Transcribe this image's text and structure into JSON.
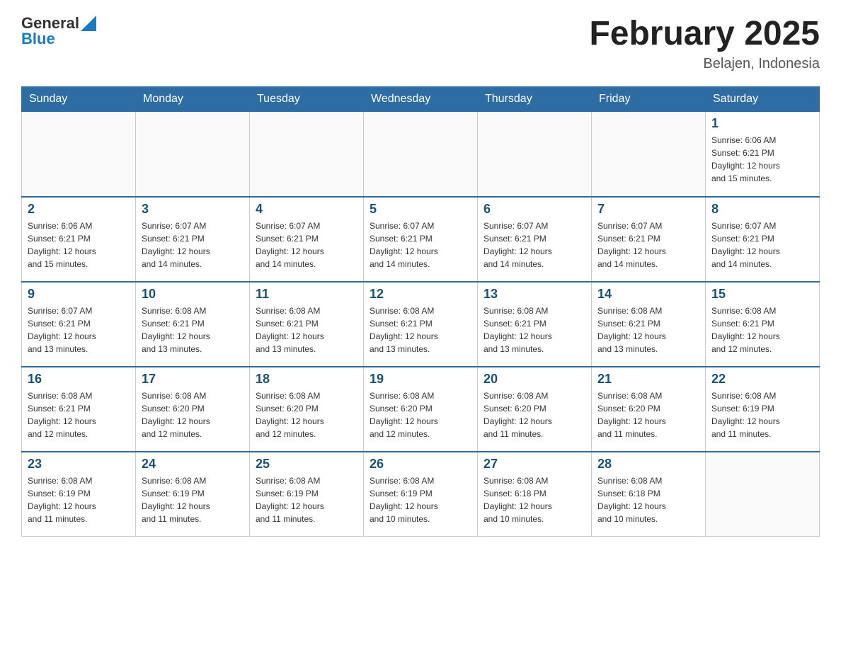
{
  "header": {
    "title": "February 2025",
    "location": "Belajen, Indonesia"
  },
  "logo": {
    "line1": "General",
    "line2": "Blue"
  },
  "weekdays": [
    "Sunday",
    "Monday",
    "Tuesday",
    "Wednesday",
    "Thursday",
    "Friday",
    "Saturday"
  ],
  "weeks": [
    [
      {
        "day": "",
        "info": ""
      },
      {
        "day": "",
        "info": ""
      },
      {
        "day": "",
        "info": ""
      },
      {
        "day": "",
        "info": ""
      },
      {
        "day": "",
        "info": ""
      },
      {
        "day": "",
        "info": ""
      },
      {
        "day": "1",
        "info": "Sunrise: 6:06 AM\nSunset: 6:21 PM\nDaylight: 12 hours\nand 15 minutes."
      }
    ],
    [
      {
        "day": "2",
        "info": "Sunrise: 6:06 AM\nSunset: 6:21 PM\nDaylight: 12 hours\nand 15 minutes."
      },
      {
        "day": "3",
        "info": "Sunrise: 6:07 AM\nSunset: 6:21 PM\nDaylight: 12 hours\nand 14 minutes."
      },
      {
        "day": "4",
        "info": "Sunrise: 6:07 AM\nSunset: 6:21 PM\nDaylight: 12 hours\nand 14 minutes."
      },
      {
        "day": "5",
        "info": "Sunrise: 6:07 AM\nSunset: 6:21 PM\nDaylight: 12 hours\nand 14 minutes."
      },
      {
        "day": "6",
        "info": "Sunrise: 6:07 AM\nSunset: 6:21 PM\nDaylight: 12 hours\nand 14 minutes."
      },
      {
        "day": "7",
        "info": "Sunrise: 6:07 AM\nSunset: 6:21 PM\nDaylight: 12 hours\nand 14 minutes."
      },
      {
        "day": "8",
        "info": "Sunrise: 6:07 AM\nSunset: 6:21 PM\nDaylight: 12 hours\nand 14 minutes."
      }
    ],
    [
      {
        "day": "9",
        "info": "Sunrise: 6:07 AM\nSunset: 6:21 PM\nDaylight: 12 hours\nand 13 minutes."
      },
      {
        "day": "10",
        "info": "Sunrise: 6:08 AM\nSunset: 6:21 PM\nDaylight: 12 hours\nand 13 minutes."
      },
      {
        "day": "11",
        "info": "Sunrise: 6:08 AM\nSunset: 6:21 PM\nDaylight: 12 hours\nand 13 minutes."
      },
      {
        "day": "12",
        "info": "Sunrise: 6:08 AM\nSunset: 6:21 PM\nDaylight: 12 hours\nand 13 minutes."
      },
      {
        "day": "13",
        "info": "Sunrise: 6:08 AM\nSunset: 6:21 PM\nDaylight: 12 hours\nand 13 minutes."
      },
      {
        "day": "14",
        "info": "Sunrise: 6:08 AM\nSunset: 6:21 PM\nDaylight: 12 hours\nand 13 minutes."
      },
      {
        "day": "15",
        "info": "Sunrise: 6:08 AM\nSunset: 6:21 PM\nDaylight: 12 hours\nand 12 minutes."
      }
    ],
    [
      {
        "day": "16",
        "info": "Sunrise: 6:08 AM\nSunset: 6:21 PM\nDaylight: 12 hours\nand 12 minutes."
      },
      {
        "day": "17",
        "info": "Sunrise: 6:08 AM\nSunset: 6:20 PM\nDaylight: 12 hours\nand 12 minutes."
      },
      {
        "day": "18",
        "info": "Sunrise: 6:08 AM\nSunset: 6:20 PM\nDaylight: 12 hours\nand 12 minutes."
      },
      {
        "day": "19",
        "info": "Sunrise: 6:08 AM\nSunset: 6:20 PM\nDaylight: 12 hours\nand 12 minutes."
      },
      {
        "day": "20",
        "info": "Sunrise: 6:08 AM\nSunset: 6:20 PM\nDaylight: 12 hours\nand 11 minutes."
      },
      {
        "day": "21",
        "info": "Sunrise: 6:08 AM\nSunset: 6:20 PM\nDaylight: 12 hours\nand 11 minutes."
      },
      {
        "day": "22",
        "info": "Sunrise: 6:08 AM\nSunset: 6:19 PM\nDaylight: 12 hours\nand 11 minutes."
      }
    ],
    [
      {
        "day": "23",
        "info": "Sunrise: 6:08 AM\nSunset: 6:19 PM\nDaylight: 12 hours\nand 11 minutes."
      },
      {
        "day": "24",
        "info": "Sunrise: 6:08 AM\nSunset: 6:19 PM\nDaylight: 12 hours\nand 11 minutes."
      },
      {
        "day": "25",
        "info": "Sunrise: 6:08 AM\nSunset: 6:19 PM\nDaylight: 12 hours\nand 11 minutes."
      },
      {
        "day": "26",
        "info": "Sunrise: 6:08 AM\nSunset: 6:19 PM\nDaylight: 12 hours\nand 10 minutes."
      },
      {
        "day": "27",
        "info": "Sunrise: 6:08 AM\nSunset: 6:18 PM\nDaylight: 12 hours\nand 10 minutes."
      },
      {
        "day": "28",
        "info": "Sunrise: 6:08 AM\nSunset: 6:18 PM\nDaylight: 12 hours\nand 10 minutes."
      },
      {
        "day": "",
        "info": ""
      }
    ]
  ]
}
